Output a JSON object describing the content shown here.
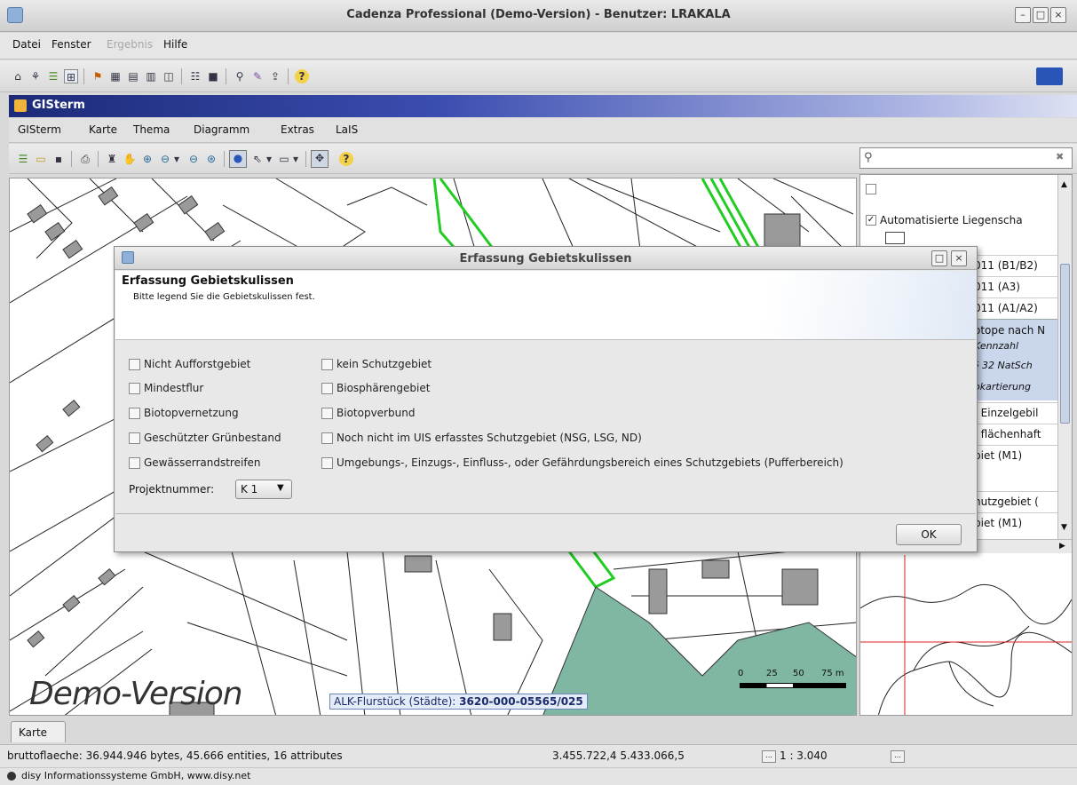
{
  "window": {
    "title": "Cadenza Professional (Demo-Version) - Benutzer: LRAKALA"
  },
  "main_menu": [
    "Datei",
    "Fenster",
    "Ergebnis",
    "Hilfe"
  ],
  "gisterm": {
    "title": "GISterm",
    "menu": [
      "GISterm",
      "Karte",
      "Thema",
      "Diagramm",
      "Extras",
      "LaIS"
    ]
  },
  "search": {
    "value": ""
  },
  "legend": {
    "items": [
      "Automatisierte Liegenscha",
      "011 (B1/B2)",
      "011 (A3)",
      "011 (A1/A2)",
      "otope nach N",
      "Kennzahl",
      "§ 32 NatSch",
      "okartierung",
      ", Einzelgebil",
      ", flächenhaft",
      "biet (M1)",
      "hutzgebiet (",
      "biet (M1)"
    ]
  },
  "map": {
    "watermark": "Demo-Version",
    "tooltip_label": "ALK-Flurstück (Städte):",
    "tooltip_value": "3620-000-05565/025",
    "scalebar_labels": [
      "0",
      "25",
      "50",
      "75 m"
    ],
    "tab_label": "Karte"
  },
  "dialog": {
    "title": "Erfassung Gebietskulissen",
    "heading": "Erfassung Gebietskulissen",
    "subtitle": "Bitte legend Sie die Gebietskulissen fest.",
    "checkboxes_left": [
      "Nicht Aufforstgebiet",
      "Mindestflur",
      "Biotopvernetzung",
      "Geschützter Grünbestand",
      "Gewässerrandstreifen"
    ],
    "checkboxes_right": [
      "kein Schutzgebiet",
      "Biosphärengebiet",
      "Biotopverbund",
      "Noch nicht im UIS erfasstes Schutzgebiet (NSG, LSG, ND)",
      "Umgebungs-, Einzugs-, Einfluss-, oder Gefährdungsbereich eines Schutzgebiets (Pufferbereich)"
    ],
    "project_label": "Projektnummer:",
    "project_value": "K 1",
    "ok_label": "OK"
  },
  "status": {
    "info": "bruttoflaeche: 36.944.946 bytes, 45.666 entities, 16 attributes",
    "coords": "3.455.722,4  5.433.066,5",
    "scale": "1 : 3.040",
    "copyright": "disy Informationssysteme GmbH, www.disy.net"
  },
  "colors": {
    "accent": "#1c2a78",
    "map_fill": "#7fb7a3",
    "green_line": "#22cc22"
  }
}
